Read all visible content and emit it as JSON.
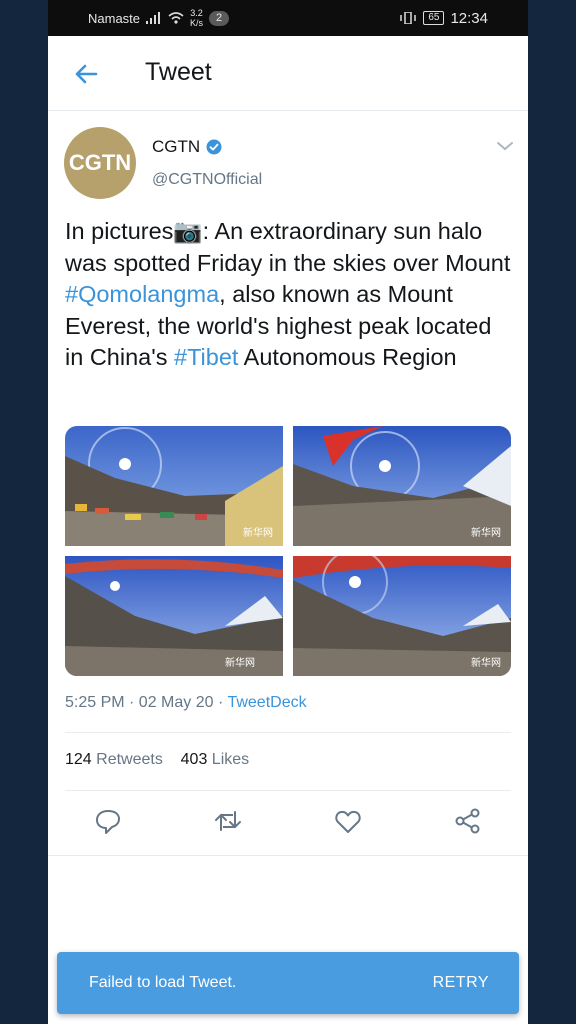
{
  "status_bar": {
    "carrier": "Namaste",
    "speed_value": "3.2",
    "speed_unit": "K/s",
    "notification_count": "2",
    "battery": "65",
    "time": "12:34"
  },
  "header": {
    "title": "Tweet"
  },
  "tweet": {
    "avatar_text": "CGTN",
    "author_name": "CGTN",
    "handle": "@CGTNOfficial",
    "text_part1": "In pictures📷: An extraordinary sun halo was spotted Friday in the skies over Mount ",
    "hashtag1": "#Qomolangma",
    "text_part2": ", also known as Mount Everest, the world's highest peak located in China's ",
    "hashtag2": "#Tibet",
    "text_part3": " Autonomous Region",
    "time": "5:25 PM · 02 May 20 · ",
    "source": "TweetDeck",
    "retweets_count": "124",
    "retweets_label": "Retweets",
    "likes_count": "403",
    "likes_label": "Likes",
    "watermark": "新华网"
  },
  "toast": {
    "message": "Failed to load Tweet.",
    "action": "RETRY"
  },
  "colors": {
    "accent": "#3b94d9",
    "toast": "#4a9ce0",
    "avatar": "#b6a16c"
  },
  "icons": [
    "back-arrow-icon",
    "verified-icon",
    "chevron-down-icon",
    "reply-icon",
    "retweet-icon",
    "like-icon",
    "share-icon"
  ]
}
